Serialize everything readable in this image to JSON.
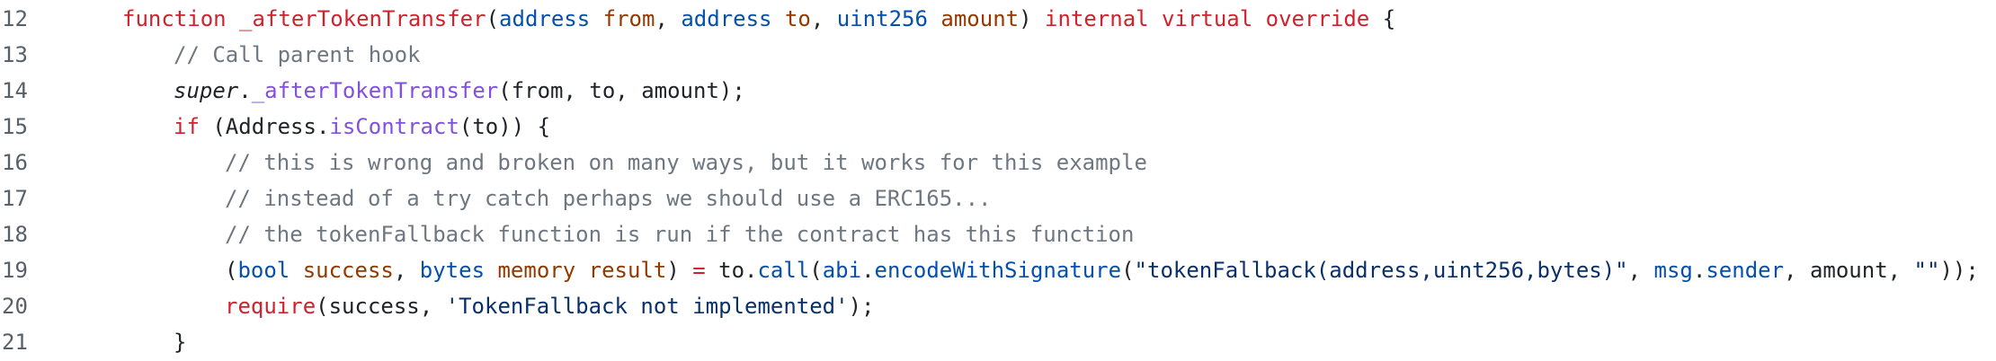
{
  "code": {
    "lines": [
      {
        "number": "12",
        "indent": 1,
        "tokens": [
          {
            "t": "function",
            "c": "kw"
          },
          {
            "t": " ",
            "c": "pl"
          },
          {
            "t": "_afterTokenTransfer",
            "c": "kw"
          },
          {
            "t": "(",
            "c": "pl"
          },
          {
            "t": "address",
            "c": "type"
          },
          {
            "t": " ",
            "c": "pl"
          },
          {
            "t": "from",
            "c": "var"
          },
          {
            "t": ", ",
            "c": "pl"
          },
          {
            "t": "address",
            "c": "type"
          },
          {
            "t": " ",
            "c": "pl"
          },
          {
            "t": "to",
            "c": "var"
          },
          {
            "t": ", ",
            "c": "pl"
          },
          {
            "t": "uint256",
            "c": "type"
          },
          {
            "t": " ",
            "c": "pl"
          },
          {
            "t": "amount",
            "c": "var"
          },
          {
            "t": ") ",
            "c": "pl"
          },
          {
            "t": "internal",
            "c": "kw"
          },
          {
            "t": " ",
            "c": "pl"
          },
          {
            "t": "virtual",
            "c": "kw"
          },
          {
            "t": " ",
            "c": "pl"
          },
          {
            "t": "override",
            "c": "kw"
          },
          {
            "t": " {",
            "c": "pl"
          }
        ]
      },
      {
        "number": "13",
        "indent": 2,
        "tokens": [
          {
            "t": "// Call parent hook",
            "c": "cm"
          }
        ]
      },
      {
        "number": "14",
        "indent": 2,
        "tokens": [
          {
            "t": "super",
            "c": "it"
          },
          {
            "t": ".",
            "c": "pl"
          },
          {
            "t": "_afterTokenTransfer",
            "c": "fn"
          },
          {
            "t": "(from, to, amount);",
            "c": "pl"
          }
        ]
      },
      {
        "number": "15",
        "indent": 2,
        "tokens": [
          {
            "t": "if",
            "c": "kw"
          },
          {
            "t": " (Address.",
            "c": "pl"
          },
          {
            "t": "isContract",
            "c": "fn"
          },
          {
            "t": "(to)) {",
            "c": "pl"
          }
        ]
      },
      {
        "number": "16",
        "indent": 3,
        "tokens": [
          {
            "t": "// this is wrong and broken on many ways, but it works for this example",
            "c": "cm"
          }
        ]
      },
      {
        "number": "17",
        "indent": 3,
        "tokens": [
          {
            "t": "// instead of a try catch perhaps we should use a ERC165...",
            "c": "cm"
          }
        ]
      },
      {
        "number": "18",
        "indent": 3,
        "tokens": [
          {
            "t": "// the tokenFallback function is run if the contract has this function",
            "c": "cm"
          }
        ]
      },
      {
        "number": "19",
        "indent": 3,
        "tokens": [
          {
            "t": "(",
            "c": "pl"
          },
          {
            "t": "bool",
            "c": "type"
          },
          {
            "t": " ",
            "c": "pl"
          },
          {
            "t": "success",
            "c": "var"
          },
          {
            "t": ", ",
            "c": "pl"
          },
          {
            "t": "bytes",
            "c": "type"
          },
          {
            "t": " ",
            "c": "pl"
          },
          {
            "t": "memory",
            "c": "var"
          },
          {
            "t": " ",
            "c": "pl"
          },
          {
            "t": "result",
            "c": "var"
          },
          {
            "t": ") ",
            "c": "pl"
          },
          {
            "t": "=",
            "c": "kw"
          },
          {
            "t": " to.",
            "c": "pl"
          },
          {
            "t": "call",
            "c": "type"
          },
          {
            "t": "(",
            "c": "pl"
          },
          {
            "t": "abi",
            "c": "type"
          },
          {
            "t": ".",
            "c": "pl"
          },
          {
            "t": "encodeWithSignature",
            "c": "type"
          },
          {
            "t": "(",
            "c": "pl"
          },
          {
            "t": "\"tokenFallback(address,uint256,bytes)\"",
            "c": "str"
          },
          {
            "t": ", ",
            "c": "pl"
          },
          {
            "t": "msg",
            "c": "type"
          },
          {
            "t": ".",
            "c": "pl"
          },
          {
            "t": "sender",
            "c": "type"
          },
          {
            "t": ", amount, ",
            "c": "pl"
          },
          {
            "t": "\"\"",
            "c": "str"
          },
          {
            "t": "));",
            "c": "pl"
          }
        ]
      },
      {
        "number": "20",
        "indent": 3,
        "tokens": [
          {
            "t": "require",
            "c": "kw"
          },
          {
            "t": "(success, ",
            "c": "pl"
          },
          {
            "t": "'TokenFallback not implemented'",
            "c": "str"
          },
          {
            "t": ");",
            "c": "pl"
          }
        ]
      },
      {
        "number": "21",
        "indent": 2,
        "tokens": [
          {
            "t": "}",
            "c": "pl"
          }
        ]
      }
    ]
  }
}
